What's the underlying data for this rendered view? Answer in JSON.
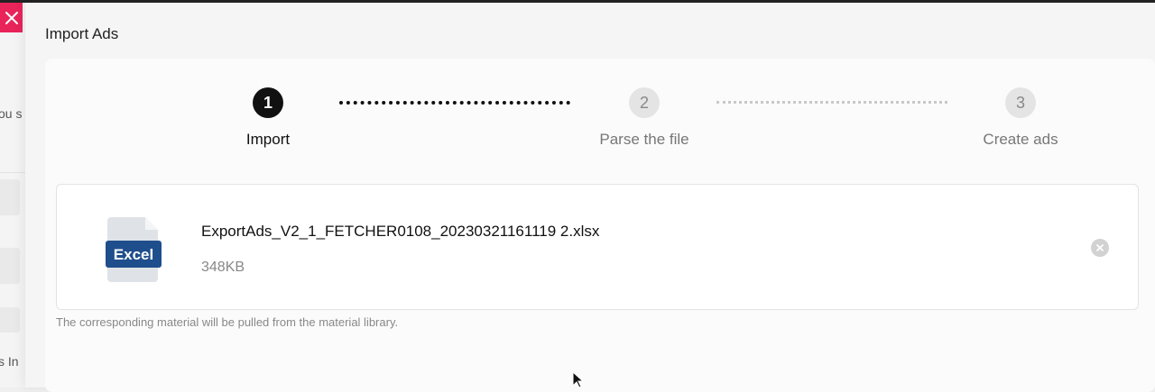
{
  "background": {
    "snippet_top": "ou s",
    "snippet_bottom": "s In"
  },
  "drawer": {
    "title": "Import Ads"
  },
  "steps": [
    {
      "number": "1",
      "label": "Import",
      "state": "active"
    },
    {
      "number": "2",
      "label": "Parse the file",
      "state": "inactive"
    },
    {
      "number": "3",
      "label": "Create ads",
      "state": "inactive"
    }
  ],
  "file": {
    "icon_label": "Excel",
    "name": "ExportAds_V2_1_FETCHER0108_20230321161119 2.xlsx",
    "size": "348KB"
  },
  "hint": "The corresponding material will be pulled from the material library.",
  "colors": {
    "close_accent": "#e8245a",
    "excel_badge": "#1f4e8c",
    "active_step": "#111111"
  }
}
